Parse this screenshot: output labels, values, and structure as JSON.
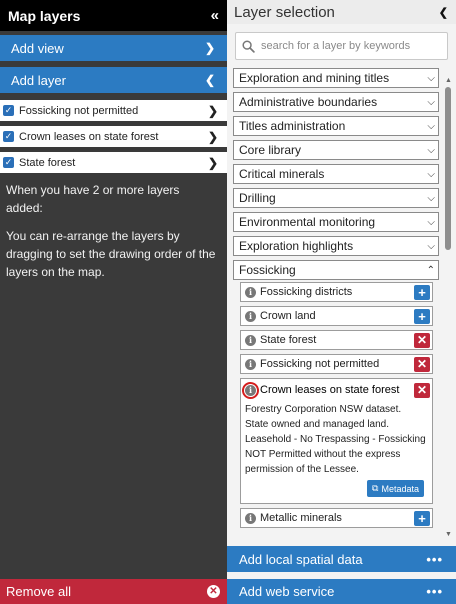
{
  "left": {
    "title": "Map layers",
    "collapse_glyph": "«",
    "add_view_label": "Add view",
    "add_layer_label": "Add layer",
    "active_layers": [
      {
        "label": "Fossicking not permitted"
      },
      {
        "label": "Crown leases on state forest"
      },
      {
        "label": "State forest"
      }
    ],
    "help_line1": "When you have 2 or more layers added:",
    "help_line2": "You can re-arrange the layers by dragging to set the drawing order of the layers on the map.",
    "remove_all_label": "Remove all"
  },
  "right": {
    "title": "Layer selection",
    "search_placeholder": "search for a layer by keywords",
    "categories": [
      "Exploration and mining titles",
      "Administrative boundaries",
      "Titles administration",
      "Core library",
      "Critical minerals",
      "Drilling",
      "Environmental monitoring",
      "Exploration highlights",
      "Fossicking"
    ],
    "fossicking_layers": [
      {
        "label": "Fossicking districts",
        "action": "add"
      },
      {
        "label": "Crown land",
        "action": "add"
      },
      {
        "label": "State forest",
        "action": "remove"
      },
      {
        "label": "Fossicking not permitted",
        "action": "remove"
      }
    ],
    "expanded_layer": {
      "label": "Crown leases on state forest",
      "description": "Forestry Corporation NSW dataset. State owned and managed land. Leasehold - No Trespassing - Fossicking NOT Permitted without the express permission of the Lessee.",
      "metadata_label": "Metadata"
    },
    "next_layer": {
      "label": "Metallic minerals",
      "action": "add"
    },
    "add_local_label": "Add local spatial data",
    "add_web_label": "Add web service"
  },
  "colors": {
    "accent_blue": "#2c7bc2",
    "danger_red": "#c0283b",
    "panel_dark": "#3a3a3a",
    "highlight_ring": "#d41d1d"
  }
}
